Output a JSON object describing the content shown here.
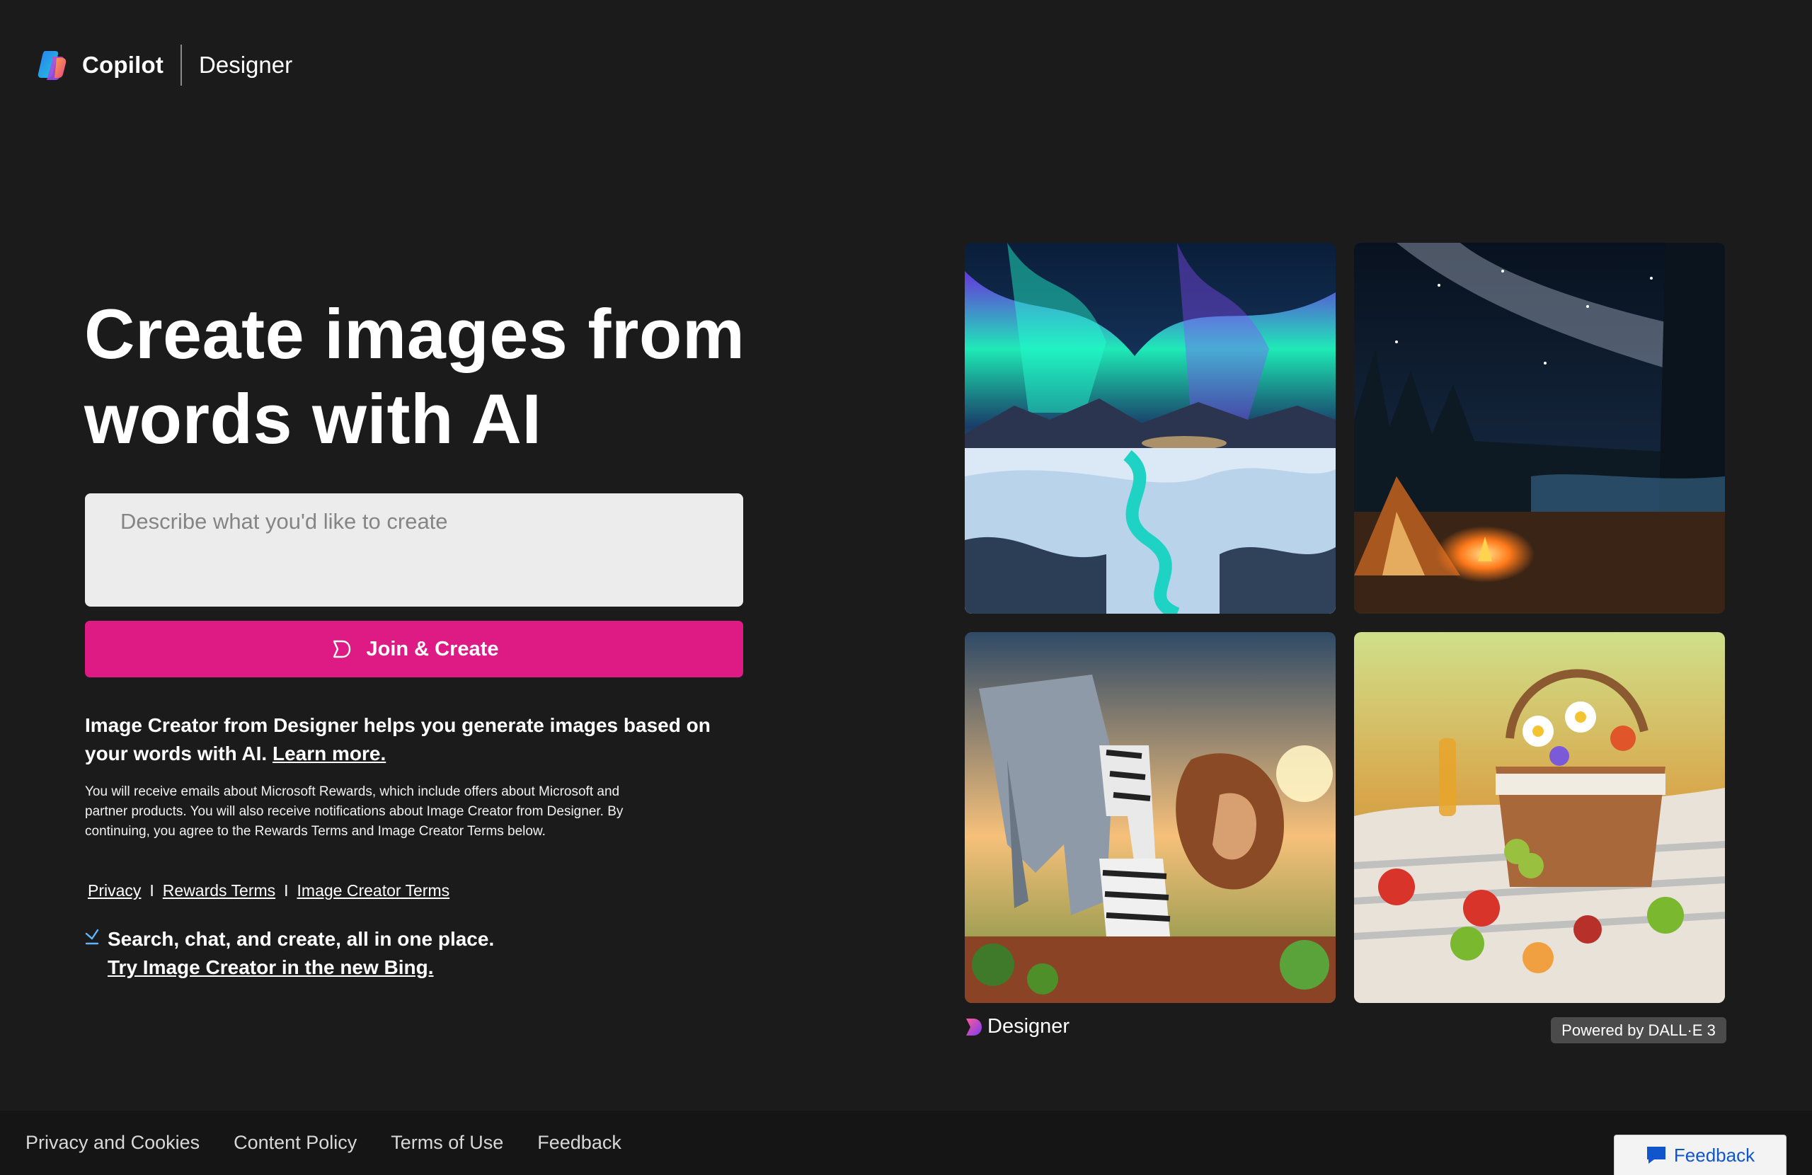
{
  "header": {
    "brand": "Copilot",
    "product": "Designer"
  },
  "hero": {
    "title": "Create images from words with AI"
  },
  "prompt": {
    "placeholder": "Describe what you'd like to create",
    "value": ""
  },
  "cta": {
    "label": "Join & Create"
  },
  "info": {
    "text": "Image Creator from Designer helps you generate images based on your words with AI.",
    "learn_more": "Learn more."
  },
  "fine_print": "You will receive emails about Microsoft Rewards, which include offers about Microsoft and partner products. You will also receive notifications about Image Creator from Designer. By continuing, you agree to the Rewards Terms and Image Creator Terms below.",
  "terms_links": {
    "privacy": "Privacy",
    "rewards_terms": "Rewards Terms",
    "image_creator_terms": "Image Creator Terms",
    "separator": "I"
  },
  "bing_promo": {
    "line1": "Search, chat, and create, all in one place.",
    "link": "Try Image Creator in the new Bing."
  },
  "gallery": {
    "images": [
      {
        "icon": "aurora-landscape-image"
      },
      {
        "icon": "night-camp-milky-way-image"
      },
      {
        "icon": "origami-animals-savanna-image"
      },
      {
        "icon": "picnic-basket-meadow-image"
      }
    ],
    "designer_label": "Designer",
    "powered_by": "Powered by DALL·E 3"
  },
  "footer": {
    "links": [
      "Privacy and Cookies",
      "Content Policy",
      "Terms of Use",
      "Feedback"
    ]
  },
  "feedback_button": {
    "label": "Feedback"
  },
  "colors": {
    "background": "#1b1b1b",
    "accent": "#de1a85",
    "footer": "#151515"
  }
}
